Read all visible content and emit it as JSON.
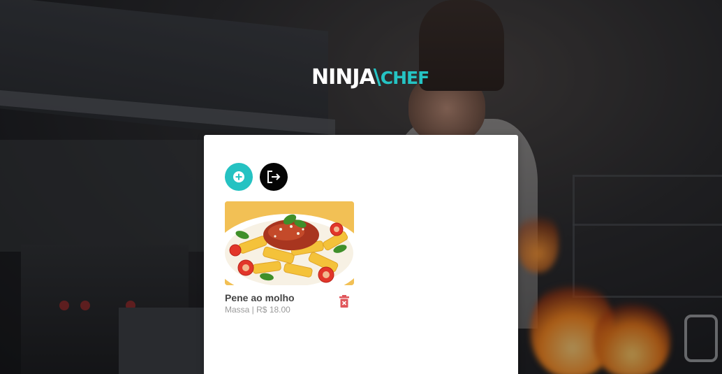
{
  "logo": {
    "part1": "NINJA",
    "part2": "CHEF"
  },
  "actions": {
    "add_icon": "plus-circle-icon",
    "logout_icon": "logout-icon"
  },
  "menu_items": [
    {
      "name": "Pene ao molho",
      "category": "Massa",
      "separator": " | ",
      "price": "R$ 18.00",
      "delete_icon": "trash-icon"
    }
  ],
  "colors": {
    "accent": "#25c2c2",
    "delete": "#e0555a",
    "logout_bg": "#050505"
  }
}
